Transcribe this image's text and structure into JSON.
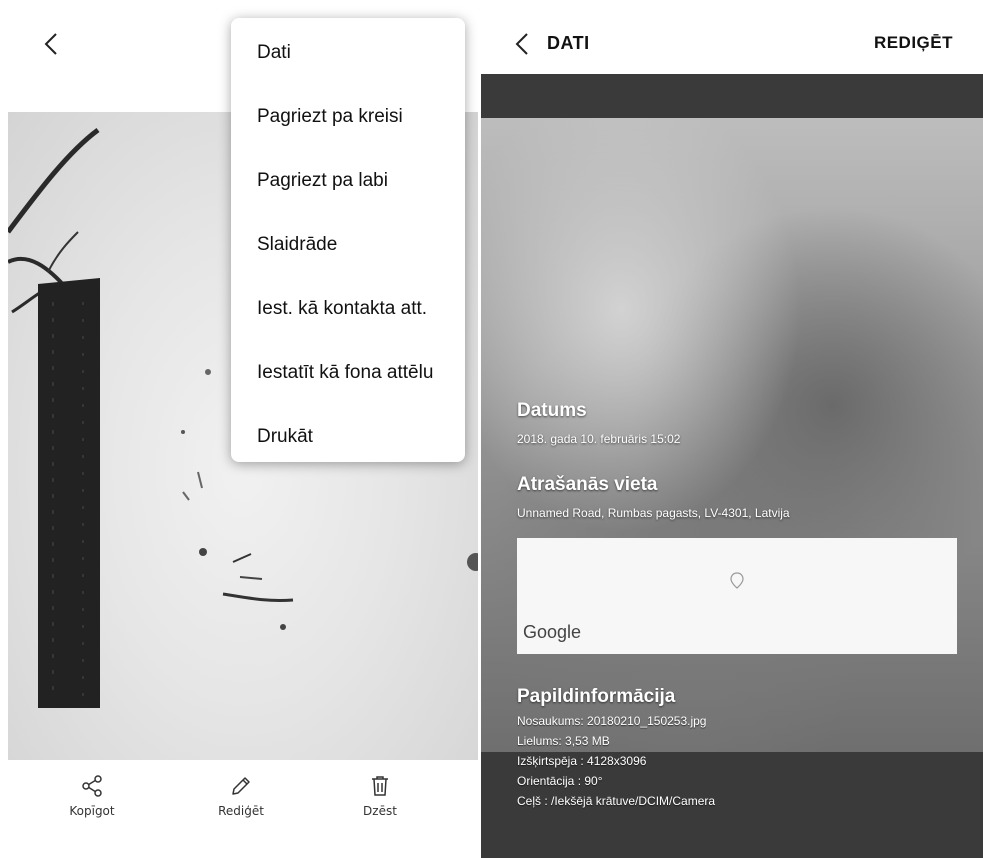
{
  "gallery": {
    "menu": {
      "items": [
        "Dati",
        "Pagriezt pa kreisi",
        "Pagriezt pa labi",
        "Slaidrāde",
        "Iest. kā kontakta att.",
        "Iestatīt kā fona attēlu",
        "Drukāt"
      ]
    },
    "actions": {
      "share": {
        "label": "Kopīgot",
        "icon": "share-icon"
      },
      "edit": {
        "label": "Rediģēt",
        "icon": "pencil-icon"
      },
      "delete": {
        "label": "Dzēst",
        "icon": "trash-icon"
      }
    }
  },
  "details": {
    "title": "DATI",
    "edit_label": "REDIĢĒT",
    "date": {
      "title": "Datums",
      "value": "2018. gada 10. februāris 15:02"
    },
    "location": {
      "title": "Atrašanās vieta",
      "value": "Unnamed Road, Rumbas pagasts, LV-4301, Latvija",
      "map_logo": "Google"
    },
    "extra": {
      "title": "Papildinformācija",
      "lines": [
        "Nosaukums: 20180210_150253.jpg",
        "Lielums: 3,53 MB",
        "Izšķirtspēja : 4128x3096",
        "Orientācija : 90°",
        "Ceļš : /Iekšējā krātuve/DCIM/Camera"
      ]
    }
  },
  "colors": {
    "panel_dark": "#3a3a3a",
    "text_light": "#ffffff",
    "menu_bg": "#ffffff"
  }
}
